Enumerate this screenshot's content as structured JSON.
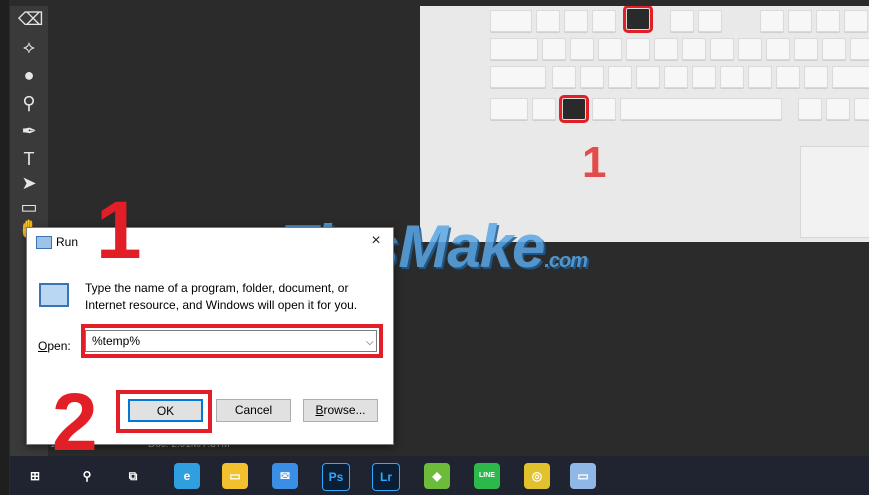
{
  "run_dialog": {
    "title": "Run",
    "close_glyph": "×",
    "description": "Type the name of a program, folder, document, or Internet resource, and Windows will open it for you.",
    "open_label_accel": "O",
    "open_label_rest": "pen:",
    "open_value": "%temp%",
    "dropdown_glyph": "⌵",
    "ok_label": "OK",
    "cancel_label": "Cancel",
    "browse_accel": "B",
    "browse_rest": "rowse..."
  },
  "annotations": {
    "step1": "1",
    "step2": "2",
    "photo_step": "1",
    "highlight_color": "#e21f26"
  },
  "watermark": {
    "main": "TipsMake",
    "suffix": ".com"
  },
  "status_bar": {
    "zoom": "16.67%",
    "doc": "Doc: 2.01M/7.37M"
  },
  "toolbar": {
    "tools": [
      "eraser-icon",
      "paint-bucket-icon",
      "blur-icon",
      "dodge-icon",
      "pen-icon",
      "type-icon",
      "path-select-icon",
      "rectangle-icon",
      "hand-icon"
    ],
    "glyphs": [
      "⌫",
      "⟡",
      "●",
      "⚲",
      "✒",
      "T",
      "➤",
      "▭",
      "✋"
    ]
  },
  "taskbar": {
    "items": [
      {
        "name": "start-button",
        "glyph": "⊞",
        "color": "#ffffff"
      },
      {
        "name": "search-button",
        "glyph": "⚲",
        "color": "#ffffff"
      },
      {
        "name": "task-view-button",
        "glyph": "⧉",
        "color": "#ffffff"
      },
      {
        "name": "edge-icon",
        "glyph": "e",
        "color": "#2f9fe0"
      },
      {
        "name": "file-explorer-icon",
        "glyph": "▭",
        "color": "#f2c12e"
      },
      {
        "name": "mail-icon",
        "glyph": "✉",
        "color": "#3a8ee6"
      },
      {
        "name": "photoshop-icon",
        "glyph": "Ps",
        "color": "#0b1e33"
      },
      {
        "name": "lightroom-icon",
        "glyph": "Lr",
        "color": "#0a1f33"
      },
      {
        "name": "layers-app-icon",
        "glyph": "◆",
        "color": "#6dbb3a"
      },
      {
        "name": "line-icon",
        "glyph": "LINE",
        "color": "#2cb84a"
      },
      {
        "name": "chrome-icon",
        "glyph": "◎",
        "color": "#e2c22c"
      },
      {
        "name": "run-app-icon",
        "glyph": "▭",
        "color": "#8fb8e6"
      }
    ]
  }
}
